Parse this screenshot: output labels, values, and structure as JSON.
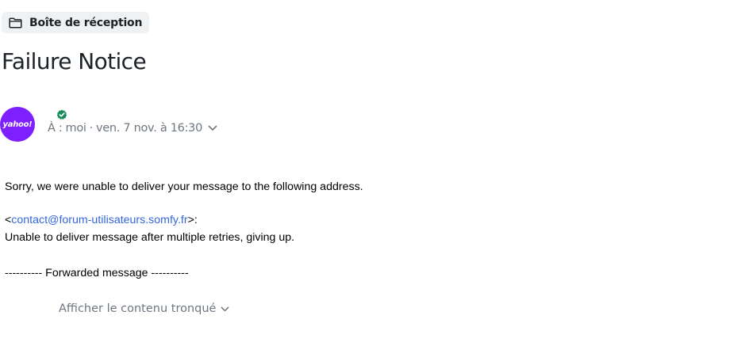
{
  "breadcrumb": {
    "folder_icon": "folder-icon",
    "folder_label": "Boîte de réception"
  },
  "message": {
    "subject": "Failure Notice",
    "sender": {
      "avatar_text": "yahoo!",
      "avatar_color": "#7e1fff",
      "verified_icon": "verified-badge-icon",
      "verified_color": "#188a5b"
    },
    "recipients": {
      "to_label": "À :",
      "to_value": "moi",
      "separator": "·",
      "date": "ven. 7 nov. à 16:30",
      "expand_icon": "chevron-down-icon"
    },
    "body": {
      "line1": "Sorry, we were unable to deliver your message to the following address.",
      "address_open": "<",
      "address": "contact@forum-utilisateurs.somfy.fr",
      "address_close": ">:",
      "line3": "Unable to deliver message after multiple retries, giving up.",
      "forwarded": "---------- Forwarded message ----------"
    },
    "show_truncated": {
      "label": "Afficher le contenu tronqué",
      "icon": "chevron-down-icon"
    }
  }
}
